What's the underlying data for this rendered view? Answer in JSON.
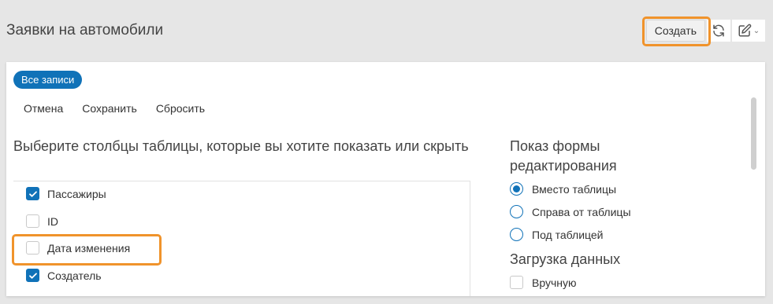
{
  "page": {
    "title": "Заявки на автомобили"
  },
  "top_actions": {
    "create_label": "Создать"
  },
  "card": {
    "pill_label": "Все записи",
    "toolbar": {
      "cancel": "Отмена",
      "save": "Сохранить",
      "reset": "Сбросить"
    },
    "columns_section": {
      "title": "Выберите столбцы таблицы, которые вы хотите показать или скрыть",
      "items": [
        {
          "label": "Пассажиры",
          "checked": true
        },
        {
          "label": "ID",
          "checked": false
        },
        {
          "label": "Дата изменения",
          "checked": false
        },
        {
          "label": "Создатель",
          "checked": true
        }
      ]
    },
    "form_section": {
      "title": "Показ формы редактирования",
      "options": [
        {
          "label": "Вместо таблицы",
          "selected": true
        },
        {
          "label": "Справа от таблицы",
          "selected": false
        },
        {
          "label": "Под таблицей",
          "selected": false
        }
      ]
    },
    "load_section": {
      "title": "Загрузка данных",
      "manual_label": "Вручную",
      "manual_checked": false
    }
  },
  "colors": {
    "accent": "#1072b8",
    "highlight": "#f0932b",
    "background": "#e6e6e6"
  }
}
